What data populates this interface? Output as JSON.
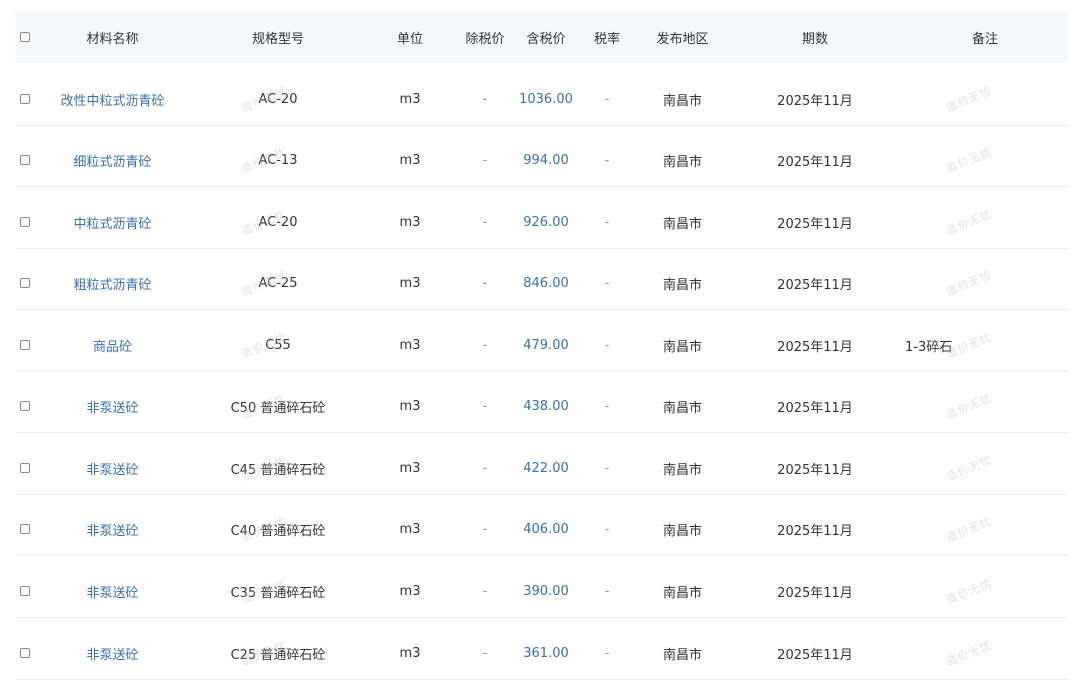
{
  "columns": {
    "name": "材料名称",
    "spec": "规格型号",
    "unit": "单位",
    "price_ex_tax": "除税价",
    "price_inc_tax": "含税价",
    "tax_rate": "税率",
    "region": "发布地区",
    "period": "期数",
    "remark": "备注"
  },
  "rows": [
    {
      "name": "改性中粒式沥青砼",
      "spec": "AC-20",
      "unit": "m3",
      "price_ex_tax": "-",
      "price_inc_tax": "1036.00",
      "tax_rate": "-",
      "region": "南昌市",
      "period": "2025年11月",
      "remark": ""
    },
    {
      "name": "细粒式沥青砼",
      "spec": "AC-13",
      "unit": "m3",
      "price_ex_tax": "-",
      "price_inc_tax": "994.00",
      "tax_rate": "-",
      "region": "南昌市",
      "period": "2025年11月",
      "remark": ""
    },
    {
      "name": "中粒式沥青砼",
      "spec": "AC-20",
      "unit": "m3",
      "price_ex_tax": "-",
      "price_inc_tax": "926.00",
      "tax_rate": "-",
      "region": "南昌市",
      "period": "2025年11月",
      "remark": ""
    },
    {
      "name": "粗粒式沥青砼",
      "spec": "AC-25",
      "unit": "m3",
      "price_ex_tax": "-",
      "price_inc_tax": "846.00",
      "tax_rate": "-",
      "region": "南昌市",
      "period": "2025年11月",
      "remark": ""
    },
    {
      "name": "商品砼",
      "spec": "C55",
      "unit": "m3",
      "price_ex_tax": "-",
      "price_inc_tax": "479.00",
      "tax_rate": "-",
      "region": "南昌市",
      "period": "2025年11月",
      "remark": "1-3碎石"
    },
    {
      "name": "非泵送砼",
      "spec": "C50 普通碎石砼",
      "unit": "m3",
      "price_ex_tax": "-",
      "price_inc_tax": "438.00",
      "tax_rate": "-",
      "region": "南昌市",
      "period": "2025年11月",
      "remark": ""
    },
    {
      "name": "非泵送砼",
      "spec": "C45 普通碎石砼",
      "unit": "m3",
      "price_ex_tax": "-",
      "price_inc_tax": "422.00",
      "tax_rate": "-",
      "region": "南昌市",
      "period": "2025年11月",
      "remark": ""
    },
    {
      "name": "非泵送砼",
      "spec": "C40 普通碎石砼",
      "unit": "m3",
      "price_ex_tax": "-",
      "price_inc_tax": "406.00",
      "tax_rate": "-",
      "region": "南昌市",
      "period": "2025年11月",
      "remark": ""
    },
    {
      "name": "非泵送砼",
      "spec": "C35 普通碎石砼",
      "unit": "m3",
      "price_ex_tax": "-",
      "price_inc_tax": "390.00",
      "tax_rate": "-",
      "region": "南昌市",
      "period": "2025年11月",
      "remark": ""
    },
    {
      "name": "非泵送砼",
      "spec": "C25 普通碎石砼",
      "unit": "m3",
      "price_ex_tax": "-",
      "price_inc_tax": "361.00",
      "tax_rate": "-",
      "region": "南昌市",
      "period": "2025年11月",
      "remark": ""
    }
  ],
  "watermark": "造价无忧",
  "colors": {
    "link": "#3d6fa7",
    "header_bg": "#f4f8fb",
    "border": "#e8ecf0"
  }
}
